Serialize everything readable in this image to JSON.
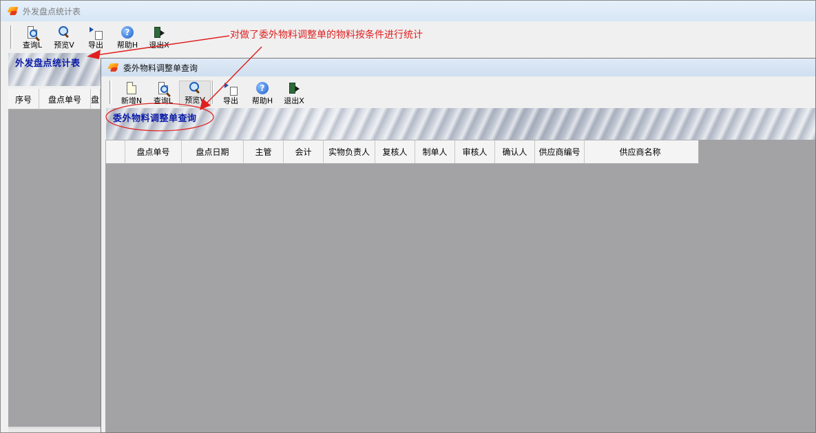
{
  "outer_window": {
    "title": "外发盘点统计表",
    "toolbar": [
      {
        "label": "查询L",
        "icon": "query-doc-icon"
      },
      {
        "label": "预览V",
        "icon": "magnifier-icon"
      },
      {
        "label": "导出",
        "icon": "export-icon"
      },
      {
        "label": "帮助H",
        "icon": "help-icon"
      },
      {
        "label": "退出X",
        "icon": "exit-icon"
      }
    ],
    "banner_title": "外发盘点统计表",
    "columns": [
      "序号",
      "盘点单号",
      "盘"
    ]
  },
  "inner_window": {
    "title": "委外物料调整单查询",
    "toolbar": [
      {
        "label": "新增N",
        "icon": "new-doc-icon"
      },
      {
        "label": "查询L",
        "icon": "query-doc-icon"
      },
      {
        "label": "预览V",
        "icon": "magnifier-icon"
      },
      {
        "label": "导出",
        "icon": "export-icon"
      },
      {
        "label": "帮助H",
        "icon": "help-icon"
      },
      {
        "label": "退出X",
        "icon": "exit-icon"
      }
    ],
    "banner_title": "委外物料调整单查询",
    "columns": [
      "",
      "盘点单号",
      "盘点日期",
      "主管",
      "会计",
      "实物负责人",
      "复核人",
      "制单人",
      "审核人",
      "确认人",
      "供应商编号",
      "供应商名称"
    ]
  },
  "annotation": {
    "text": "对做了委外物料调整单的物料按条件进行统计",
    "color": "#e02020"
  },
  "colors": {
    "banner_title": "#0a1aa8",
    "grid_background": "#a3a3a6"
  }
}
